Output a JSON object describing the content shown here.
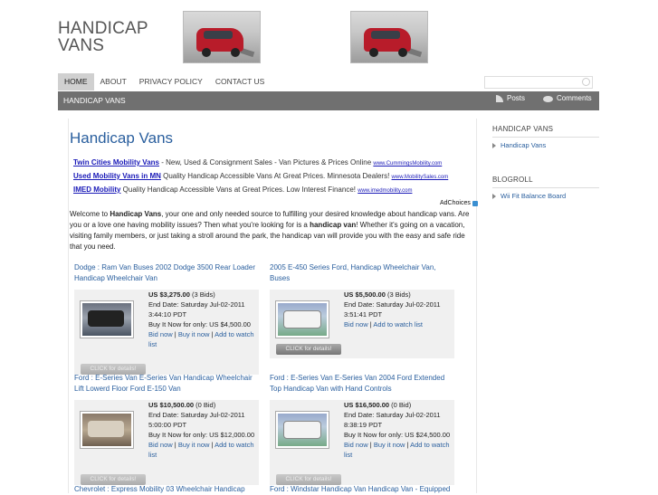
{
  "site": {
    "title_line1": "HANDICAP",
    "title_line2": "VANS"
  },
  "nav": {
    "items": [
      "HOME",
      "ABOUT",
      "PRIVACY POLICY",
      "CONTACT US"
    ]
  },
  "bar": {
    "label": "HANDICAP VANS",
    "posts": "Posts",
    "comments": "Comments"
  },
  "main": {
    "title": "Handicap Vans",
    "ads": [
      {
        "link": "Twin Cities Mobility Vans",
        "text": " - New, Used & Consignment Sales - Van Pictures & Prices Online ",
        "url": "www.CummingsMobility.com"
      },
      {
        "link": "Used Mobility Vans in MN",
        "text": " Quality Handicap Accessible Vans At Great Prices. Minnesota Dealers! ",
        "url": "www.MobilitySales.com"
      },
      {
        "link": "IMED Mobility",
        "text": " Quality Handicap Accessible Vans at Great Prices. Low Interest Finance! ",
        "url": "www.imedmobility.com"
      }
    ],
    "adchoices": "AdChoices",
    "intro": {
      "p1": "Welcome to ",
      "b1": "Handicap Vans",
      "p2": ", your one and only needed source to fulfilling your desired knowledge about handicap vans. Are you or a love one having mobility issues? Then what you're looking for is a ",
      "b2": "handicap van",
      "p3": "! Whether it's going on a vacation, visiting family members, or just taking a stroll around the park, the handicap van will provide you with the easy and safe ride that you need."
    },
    "items": [
      {
        "title": "Dodge : Ram Van Buses 2002 Dodge 3500 Rear Loader Handicap Wheelchair Van",
        "price": "US $3,275.00",
        "bids": " (3 Bids)",
        "end": "End Date: Saturday Jul-02-2011 3:44:10 PDT",
        "buy": "Buy It Now for only: US $4,500.00",
        "bid_now": "Bid now",
        "buy_now": "Buy it now",
        "watch": "Add to watch list"
      },
      {
        "title": "2005 E-450 Series Ford, Handicap Wheelchair Van, Buses",
        "price": "US $5,500.00",
        "bids": " (3 Bids)",
        "end": "End Date: Saturday Jul-02-2011 3:51:41 PDT",
        "bid_now": "Bid now",
        "watch": "Add to watch list"
      },
      {
        "title": "Ford : E-Series Van E-Series Van Handicap Wheelchair Lift Lowerd Floor Ford E-150 Van",
        "price": "US $10,500.00",
        "bids": " (0 Bid)",
        "end": "End Date: Saturday Jul-02-2011 5:00:00 PDT",
        "buy": "Buy It Now for only: US $12,000.00",
        "bid_now": "Bid now",
        "buy_now": "Buy it now",
        "watch": "Add to watch list"
      },
      {
        "title": "Ford : E-Series Van E-Series Van 2004 Ford Extended Top Handicap Van with Hand Controls",
        "price": "US $16,500.00",
        "bids": " (0 Bid)",
        "end": "End Date: Saturday Jul-02-2011 8:38:19 PDT",
        "buy": "Buy It Now for only: US $24,500.00",
        "bid_now": "Bid now",
        "buy_now": "Buy it now",
        "watch": "Add to watch list"
      }
    ],
    "click_label": "CLICK for details!",
    "partial_titles": [
      "Chevrolet : Express Mobility 03 Wheelchair Handicap",
      "Ford : Windstar Handicap Van Handicap Van - Equipped"
    ]
  },
  "sidebar": {
    "sections": [
      {
        "heading": "HANDICAP VANS",
        "links": [
          "Handicap Vans"
        ]
      },
      {
        "heading": "BLOGROLL",
        "links": [
          "Wii Fit Balance Board"
        ]
      }
    ]
  }
}
